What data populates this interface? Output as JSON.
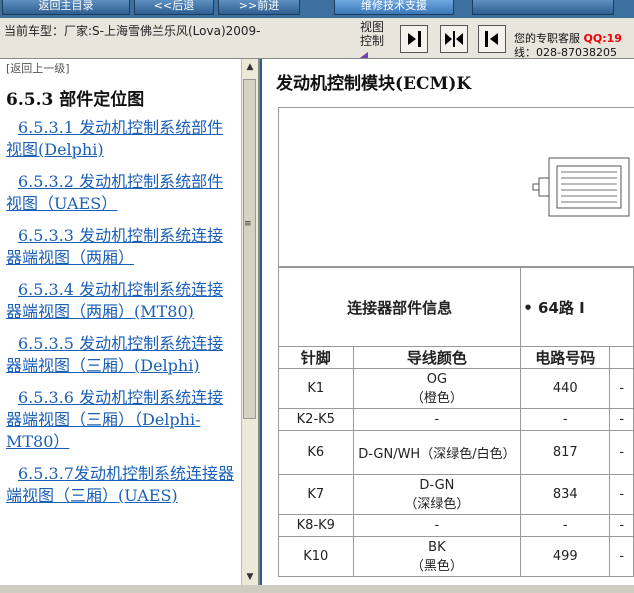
{
  "toolbar": {
    "buttons": [
      "返回主目录",
      "<<后退",
      ">>前进",
      "维修技术支援",
      ""
    ]
  },
  "info": {
    "vehicle_label": "当前车型：厂家:S-上海雪佛兰乐风(Lova)2009-",
    "view_control": "视图控制",
    "service_line1_prefix": "您的专职客服",
    "service_qq": "QQ:19",
    "service_line2": "线：028-87038205"
  },
  "nav": {
    "back_link": "[返回上一级]",
    "section_title": "6.5.3 部件定位图",
    "links": [
      "6.5.3.1 发动机控制系统部件视图(Delphi)",
      "6.5.3.2 发动机控制系统部件视图（UAES）",
      "6.5.3.3 发动机控制系统连接器端视图（两厢）",
      "6.5.3.4 发动机控制系统连接器端视图（两厢）(MT80)",
      "6.5.3.5 发动机控制系统连接器端视图（三厢）(Delphi)",
      "6.5.3.6 发动机控制系统连接器端视图（三厢）（Delphi-MT80）",
      "6.5.3.7发动机控制系统连接器端视图（三厢）(UAES)"
    ]
  },
  "content": {
    "title": "发动机控制模块(ECM)K",
    "connector_info_label": "连接器部件信息",
    "connector_info_value": "• 64路 I",
    "headers": [
      "针脚",
      "导线颜色",
      "电路号码",
      ""
    ],
    "rows": [
      {
        "pin": "K1",
        "color": "OG\n（橙色）",
        "circuit": "440",
        "extra": "-"
      },
      {
        "pin": "K2-K5",
        "color": "-",
        "circuit": "-",
        "extra": "-"
      },
      {
        "pin": "K6",
        "color": "D-GN/WH（深绿色/白色）",
        "circuit": "817",
        "extra": "-"
      },
      {
        "pin": "K7",
        "color": "D-GN\n（深绿色）",
        "circuit": "834",
        "extra": "-"
      },
      {
        "pin": "K8-K9",
        "color": "-",
        "circuit": "-",
        "extra": "-"
      },
      {
        "pin": "K10",
        "color": "BK\n（黑色）",
        "circuit": "499",
        "extra": "-"
      }
    ]
  }
}
